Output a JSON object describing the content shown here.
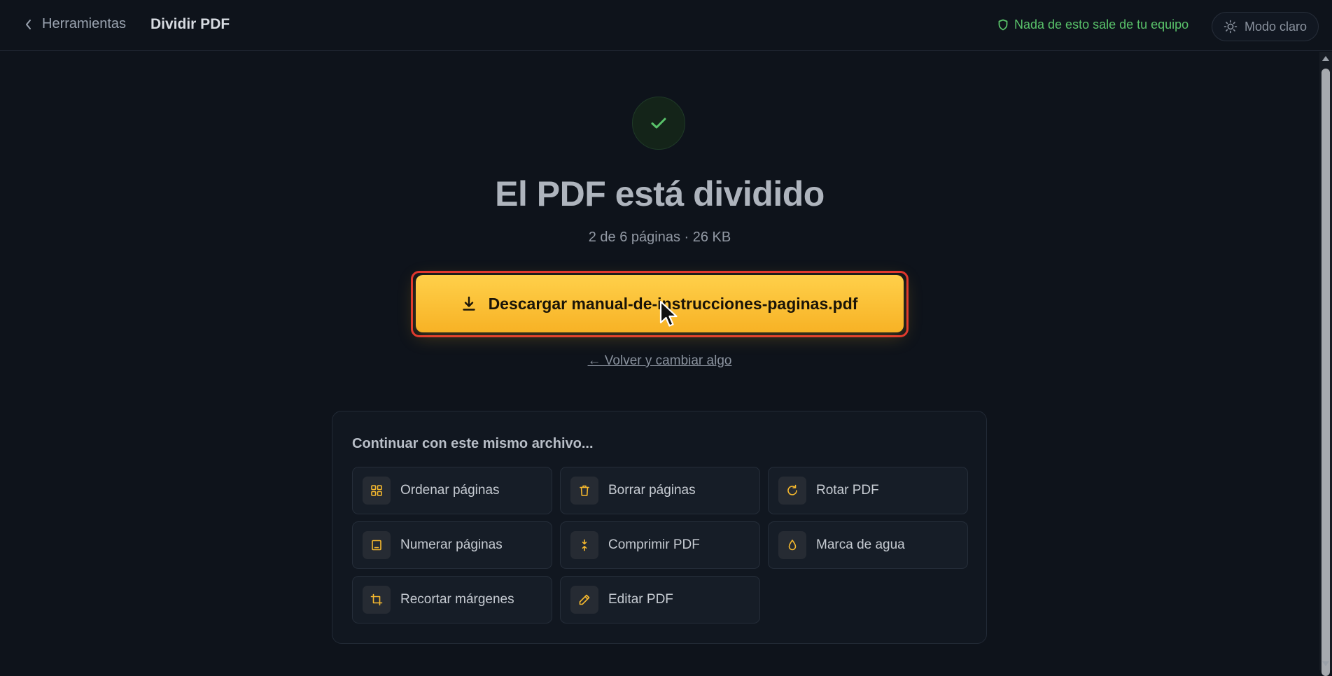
{
  "header": {
    "back_label": "Herramientas",
    "title": "Dividir PDF",
    "privacy_note": "Nada de esto sale de tu equipo",
    "mode_toggle_label": "Modo claro"
  },
  "result": {
    "headline": "El PDF está dividido",
    "meta": "2 de 6 páginas · 26 KB",
    "download_label": "Descargar manual-de-instrucciones-paginas.pdf",
    "back_link": "← Volver y cambiar algo"
  },
  "continue_panel": {
    "title": "Continuar con este mismo archivo...",
    "tools": [
      {
        "label": "Ordenar páginas",
        "icon": "grid-icon"
      },
      {
        "label": "Borrar páginas",
        "icon": "trash-icon"
      },
      {
        "label": "Rotar PDF",
        "icon": "rotate-icon"
      },
      {
        "label": "Numerar páginas",
        "icon": "page-number-icon"
      },
      {
        "label": "Comprimir PDF",
        "icon": "compress-icon"
      },
      {
        "label": "Marca de agua",
        "icon": "droplet-icon"
      },
      {
        "label": "Recortar márgenes",
        "icon": "crop-icon"
      },
      {
        "label": "Editar PDF",
        "icon": "pencil-icon"
      }
    ]
  },
  "colors": {
    "background": "#0e131b",
    "accent": "#ffc233",
    "success": "#59c26a",
    "highlight": "#e0342f"
  }
}
